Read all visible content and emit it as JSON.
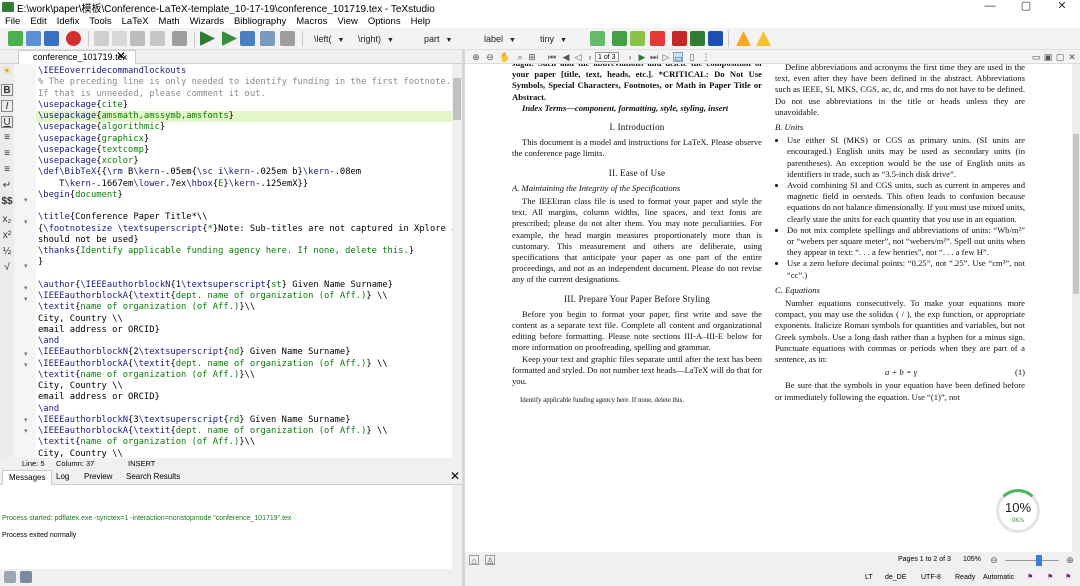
{
  "window": {
    "title": "E:\\work\\paper\\模板\\Conference-LaTeX-template_10-17-19\\conference_101719.tex - TeXstudio",
    "minimize": "—",
    "maximize": "▢",
    "close": "✕"
  },
  "menu": [
    "File",
    "Edit",
    "Idefix",
    "Tools",
    "LaTeX",
    "Math",
    "Wizards",
    "Bibliography",
    "Macros",
    "View",
    "Options",
    "Help"
  ],
  "toolbar": {
    "left_delim": "\\left(",
    "right_delim": "\\right)",
    "part": "part",
    "label": "label",
    "size": "tiny"
  },
  "editor": {
    "tab_label": "conference_101719.tex",
    "tab_close": "✕",
    "lines": [
      "\\IEEEoverridecommandlockouts",
      "% The preceding line is only needed to identify funding in the first footnote.",
      "If that is unneeded, please comment it out.",
      "\\usepackage{cite}",
      "\\usepackage{amsmath,amssymb,amsfonts}",
      "\\usepackage{algorithmic}",
      "\\usepackage{graphicx}",
      "\\usepackage{textcomp}",
      "\\usepackage{xcolor}",
      "\\def\\BibTeX{{\\rm B\\kern-.05em{\\sc i\\kern-.025em b}\\kern-.08em",
      "    T\\kern-.1667em\\lower.7ex\\hbox{E}\\kern-.125emX}}",
      "\\begin{document}",
      "",
      "\\title{Conference Paper Title*\\\\",
      "{\\footnotesize \\textsuperscript{*}Note: Sub-titles are not captured in Xplore and",
      "should not be used}",
      "\\thanks{Identify applicable funding agency here. If none, delete this.}",
      "}",
      "",
      "\\author{\\IEEEauthorblockN{1\\textsuperscript{st} Given Name Surname}",
      "\\IEEEauthorblockA{\\textit{dept. name of organization (of Aff.)} \\\\",
      "\\textit{name of organization (of Aff.)}\\\\",
      "City, Country \\\\",
      "email address or ORCID}",
      "\\and",
      "\\IEEEauthorblockN{2\\textsuperscript{nd} Given Name Surname}",
      "\\IEEEauthorblockA{\\textit{dept. name of organization (of Aff.)} \\\\",
      "\\textit{name of organization (of Aff.)}\\\\",
      "City, Country \\\\",
      "email address or ORCID}",
      "\\and",
      "\\IEEEauthorblockN{3\\textsuperscript{rd} Given Name Surname}",
      "\\IEEEauthorblockA{\\textit{dept. name of organization (of Aff.)} \\\\",
      "\\textit{name of organization (of Aff.)}\\\\",
      "City, Country \\\\"
    ],
    "status_line": "Line: 5",
    "status_col": "Column: 37",
    "status_mode": "INSERT"
  },
  "bottom": {
    "tabs": [
      "Messages",
      "Log",
      "Preview",
      "Search Results"
    ],
    "close": "✕",
    "message1": "Process started: pdflatex.exe -synctex=1 -interaction=nonstopmode \"conference_101719\".tex",
    "message2": "Process exited normally"
  },
  "pdf": {
    "page_input": "1 of 3",
    "col1_top": "sugar. Such and the abbreviations and delete the composition of your paper [title, text, heads, etc.]. *CRITICAL: Do Not Use Symbols, Special Characters, Footnotes, or Math in Paper Title or Abstract.",
    "index_terms": "Index Terms—component, formatting, style, styling, insert",
    "h_intro": "I. Introduction",
    "intro": "This document is a model and instructions for LaTeX. Please observe the conference page limits.",
    "h_ease": "II. Ease of Use",
    "h_maintain": "A. Maintaining the Integrity of the Specifications",
    "maintain": "The IEEEtran class file is used to format your paper and style the text. All margins, column widths, line spaces, and text fonts are prescribed; please do not alter them. You may note peculiarities. For example, the head margin measures proportionately more than is customary. This measurement and others are deliberate, using specifications that anticipate your paper as one part of the entire proceedings, and not as an independent document. Please do not revise any of the current designations.",
    "h_prepare": "III. Prepare Your Paper Before Styling",
    "prepare1": "Before you begin to format your paper, first write and save the content as a separate text file. Complete all content and organizational editing before formatting. Please note sections III-A–III-E below for more information on proofreading, spelling and grammar.",
    "prepare2": "Keep your text and graphic files separate until after the text has been formatted and styled. Do not number text heads—LaTeX will do that for you.",
    "footnote": "Identify applicable funding agency here. If none, delete this.",
    "col2_top": "Define abbreviations and acronyms the first time they are used in the text, even after they have been defined in the abstract. Abbreviations such as IEEE, SI, MKS, CGS, ac, dc, and rms do not have to be defined. Do not use abbreviations in the title or heads unless they are unavoidable.",
    "h_units": "B. Units",
    "units": [
      "Use either SI (MKS) or CGS as primary units. (SI units are encouraged.) English units may be used as secondary units (in parentheses). An exception would be the use of English units as identifiers in trade, such as “3.5-inch disk drive”.",
      "Avoid combining SI and CGS units, such as current in amperes and magnetic field in oersteds. This often leads to confusion because equations do not balance dimensionally. If you must use mixed units, clearly state the units for each quantity that you use in an equation.",
      "Do not mix complete spellings and abbreviations of units: “Wb/m²” or “webers per square meter”, not “webers/m²”. Spell out units when they appear in text: “. . . a few henries”, not “. . . a few H”.",
      "Use a zero before decimal points: “0.25”, not “.25”. Use “cm³”, not “cc”.)"
    ],
    "h_equations": "C. Equations",
    "equations": "Number equations consecutively. To make your equations more compact, you may use the solidus ( / ), the exp function, or appropriate exponents. Italicize Roman symbols for quantities and variables, but not Greek symbols. Use a long dash rather than a hyphen for a minus sign. Punctuate equations with commas or periods when they are part of a sentence, as in:",
    "eq": "a + b = γ",
    "eq_num": "(1)",
    "after_eq": "Be sure that the symbols in your equation have been defined before or immediately following the equation. Use “(1)”, not",
    "pages": "Pages 1 to 2 of 3",
    "zoom": "105%"
  },
  "overlay": {
    "percent": "10%",
    "speed": "0K/s"
  },
  "status": {
    "lang": "de_DE",
    "encoding": "UTF-8",
    "ready": "Ready",
    "mode": "Automatic"
  },
  "colors": {
    "green": "#2e7d32",
    "comment": "#8a8a8a",
    "keyword": "#1a1a80",
    "argument": "#0a7b0a",
    "current_line": "#e3f7c6"
  }
}
